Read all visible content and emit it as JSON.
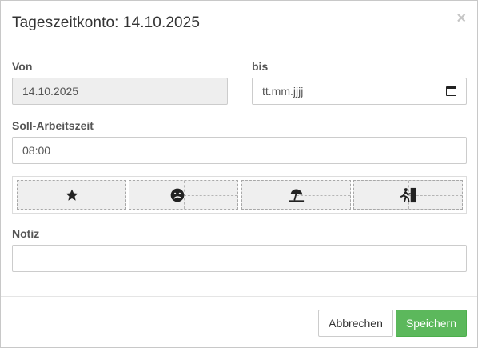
{
  "modal": {
    "title": "Tageszeitkonto: 14.10.2025",
    "close_glyph": "×"
  },
  "form": {
    "von_label": "Von",
    "von_value": "14.10.2025",
    "bis_label": "bis",
    "bis_value": "tt.mm.jjjj",
    "soll_label": "Soll-Arbeitszeit",
    "soll_value": "08:00",
    "notiz_label": "Notiz",
    "notiz_value": ""
  },
  "icon_buttons": [
    {
      "icon": "star-icon"
    },
    {
      "icon": "sick-face-icon"
    },
    {
      "icon": "beach-umbrella-icon"
    },
    {
      "icon": "exit-icon"
    }
  ],
  "footer": {
    "cancel_label": "Abbrechen",
    "save_label": "Speichern"
  },
  "colors": {
    "save_button": "#5cb85c",
    "disabled_input": "#eeeeee",
    "icon": "#222222"
  }
}
